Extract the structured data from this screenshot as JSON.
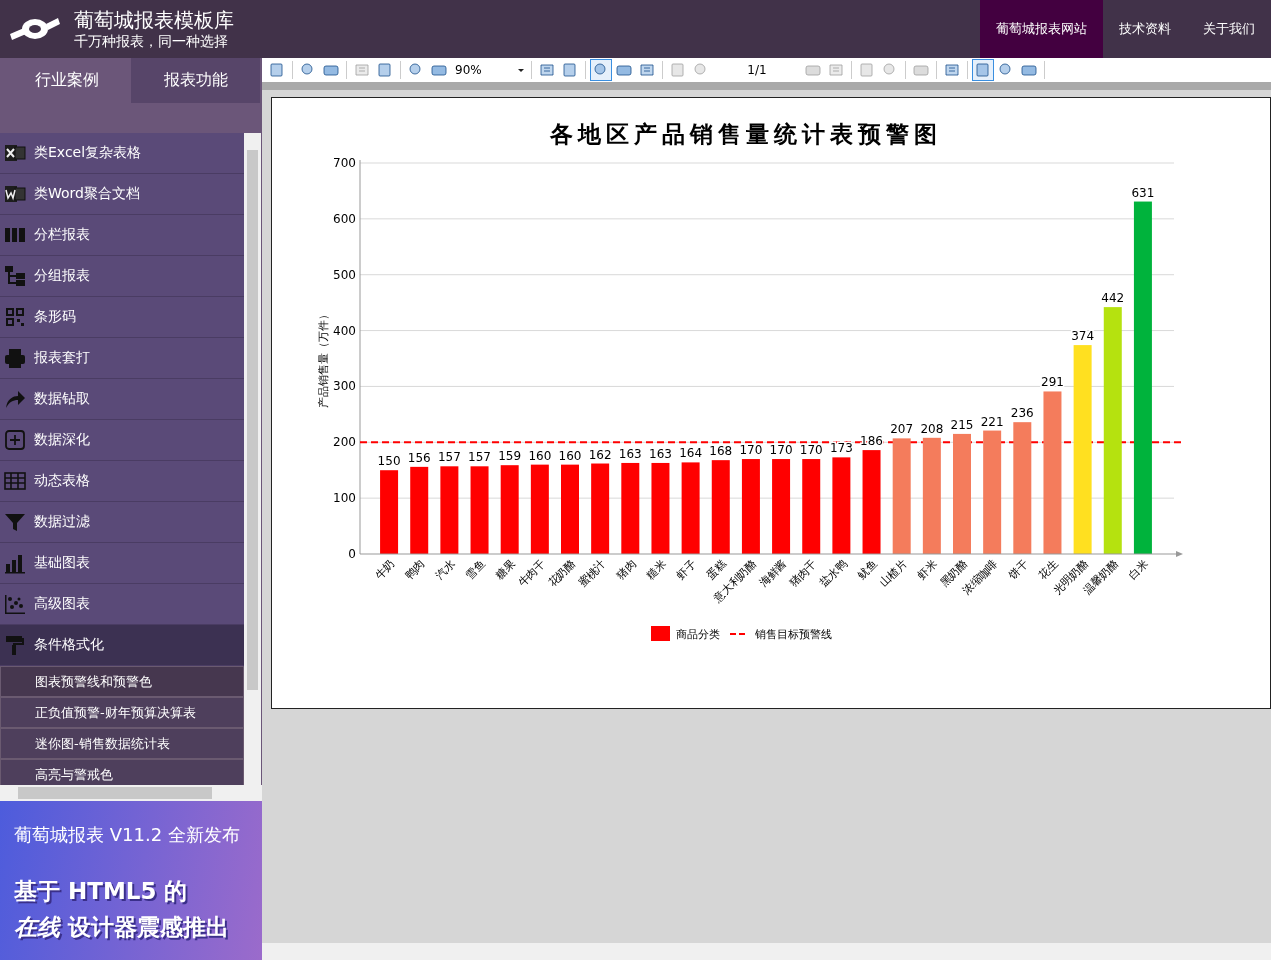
{
  "header": {
    "title": "葡萄城报表模板库",
    "subtitle": "千万种报表，同一种选择",
    "nav": [
      {
        "label": "葡萄城报表网站",
        "selected": true
      },
      {
        "label": "技术资料",
        "selected": false
      },
      {
        "label": "关于我们",
        "selected": false
      }
    ]
  },
  "sidebar": {
    "tabs": [
      {
        "label": "行业案例",
        "selected": false
      },
      {
        "label": "报表功能",
        "selected": true
      }
    ],
    "items": [
      {
        "label": "类Excel复杂表格",
        "expanded": false
      },
      {
        "label": "类Word聚合文档",
        "expanded": false
      },
      {
        "label": "分栏报表",
        "expanded": false
      },
      {
        "label": "分组报表",
        "expanded": false
      },
      {
        "label": "条形码",
        "expanded": false
      },
      {
        "label": "报表套打",
        "expanded": false
      },
      {
        "label": "数据钻取",
        "expanded": false
      },
      {
        "label": "数据深化",
        "expanded": false
      },
      {
        "label": "动态表格",
        "expanded": false
      },
      {
        "label": "数据过滤",
        "expanded": false
      },
      {
        "label": "基础图表",
        "expanded": false
      },
      {
        "label": "高级图表",
        "expanded": false
      },
      {
        "label": "条件格式化",
        "expanded": true,
        "children": [
          {
            "label": "图表预警线和预警色",
            "selected": true
          },
          {
            "label": "正负值预警-财年预算决算表",
            "selected": false
          },
          {
            "label": "迷你图-销售数据统计表",
            "selected": false
          },
          {
            "label": "高亮与警戒色",
            "selected": false
          }
        ]
      }
    ],
    "banner": {
      "line1": "葡萄城报表 V11.2 全新发布",
      "line2": "基于 HTML5 的",
      "line3": "*在线* 设计器震感推出"
    }
  },
  "toolbar": {
    "zoom": "90%",
    "page": "1/1",
    "buttons": [
      {
        "selected": false,
        "disabled": false
      },
      {
        "selected": false,
        "disabled": false
      },
      {
        "selected": false,
        "disabled": false
      },
      {
        "selected": false,
        "disabled": true
      },
      {
        "selected": false,
        "disabled": false
      },
      {
        "selected": false,
        "disabled": false
      },
      {
        "selected": false,
        "disabled": false
      },
      {
        "selected": false,
        "disabled": false
      },
      {
        "selected": false,
        "disabled": false
      },
      {
        "selected": true,
        "disabled": false
      },
      {
        "selected": false,
        "disabled": false
      },
      {
        "selected": false,
        "disabled": false
      },
      {
        "selected": false,
        "disabled": true
      },
      {
        "selected": false,
        "disabled": true
      },
      {
        "selected": false,
        "disabled": true
      },
      {
        "selected": false,
        "disabled": true
      },
      {
        "selected": false,
        "disabled": true
      },
      {
        "selected": false,
        "disabled": true
      },
      {
        "selected": false,
        "disabled": true
      },
      {
        "selected": false,
        "disabled": false
      },
      {
        "selected": true,
        "disabled": false
      },
      {
        "selected": false,
        "disabled": false
      },
      {
        "selected": false,
        "disabled": false
      }
    ]
  },
  "report": {
    "chart_data": {
      "type": "bar",
      "title": "各地区产品销售量统计表预警图",
      "ylabel": "产品销售量（万件）",
      "categories": [
        "牛奶",
        "鸭肉",
        "汽水",
        "雪鱼",
        "糖果",
        "牛肉干",
        "花奶酪",
        "蜜桃汁",
        "猪肉",
        "糙米",
        "虾子",
        "蛋糕",
        "意大利奶酪",
        "海鲜酱",
        "猪肉干",
        "盐水鸭",
        "鱿鱼",
        "山楂片",
        "虾米",
        "黑奶酪",
        "浓缩咖啡",
        "饼干",
        "花生",
        "光明奶酪",
        "温馨奶酪",
        "白米"
      ],
      "series": [
        {
          "name": "商品分类",
          "color": "#ff0000",
          "values": [
            150,
            156,
            157,
            157,
            159,
            160,
            160,
            162,
            163,
            163,
            164,
            168,
            170,
            170,
            170,
            173,
            186,
            207,
            208,
            215,
            221,
            236,
            291,
            374,
            442,
            631
          ],
          "colors": [
            "#ff0000",
            "#ff0000",
            "#ff0000",
            "#ff0000",
            "#ff0000",
            "#ff0000",
            "#ff0000",
            "#ff0000",
            "#ff0000",
            "#ff0000",
            "#ff0000",
            "#ff0000",
            "#ff0000",
            "#ff0000",
            "#ff0000",
            "#ff0000",
            "#ff0000",
            "#f47c5c",
            "#f47c5c",
            "#f47c5c",
            "#f47c5c",
            "#f47c5c",
            "#f47c5c",
            "#ffe020",
            "#b5e20f",
            "#00b33c"
          ]
        }
      ],
      "ylim": [
        0,
        700
      ],
      "yticks": [
        0,
        100,
        200,
        300,
        400,
        500,
        600,
        700
      ],
      "data_labels": true,
      "grid": true,
      "legend": "bottom",
      "ref_lines": [
        {
          "axis": "y",
          "value": 200,
          "label": "销售目标预警线",
          "color": "#ff0000"
        }
      ]
    }
  }
}
